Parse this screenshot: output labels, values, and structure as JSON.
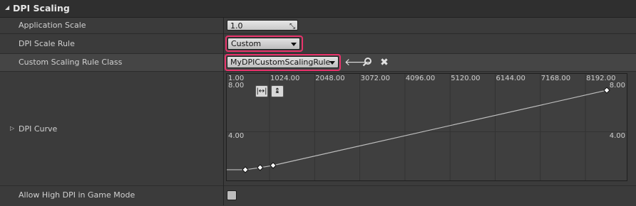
{
  "section": {
    "title": "DPI Scaling"
  },
  "rows": {
    "application_scale": {
      "label": "Application Scale",
      "value": "1.0"
    },
    "dpi_scale_rule": {
      "label": "DPI Scale Rule",
      "value": "Custom"
    },
    "custom_rule_class": {
      "label": "Custom Scaling Rule Class",
      "value": "MyDPICustomScalingRule"
    },
    "dpi_curve": {
      "label": "DPI Curve"
    },
    "allow_high_dpi": {
      "label": "Allow High DPI in Game Mode",
      "checked": false
    }
  },
  "icons": {
    "collapse": "triangle-down-icon",
    "expand": "triangle-right-icon",
    "resize": "resize-icon",
    "use_selected": "arrow-left-icon",
    "browse": "search-icon",
    "clear": "close-icon",
    "fit_horizontal": "fit-horizontal-icon",
    "fit_vertical": "fit-vertical-icon"
  },
  "chart_data": {
    "type": "line",
    "x_ticks": [
      "1.00",
      "1024.00",
      "2048.00",
      "3072.00",
      "4096.00",
      "5120.00",
      "6144.00",
      "7168.00",
      "8192.00"
    ],
    "y_ticks_left": [
      "8.00",
      "4.00"
    ],
    "y_ticks_right": [
      "8.00",
      "4.00"
    ],
    "xlim": [
      0,
      8192
    ],
    "ylim": [
      0,
      8.6
    ],
    "points": [
      {
        "x": 0,
        "y": 0.6
      },
      {
        "x": 400,
        "y": 0.6
      },
      {
        "x": 720,
        "y": 0.8
      },
      {
        "x": 1000,
        "y": 1.0
      },
      {
        "x": 8192,
        "y": 8.0
      }
    ],
    "keys": [
      {
        "x": 400,
        "y": 0.6
      },
      {
        "x": 720,
        "y": 0.8
      },
      {
        "x": 1000,
        "y": 1.0
      },
      {
        "x": 8192,
        "y": 8.0
      }
    ]
  }
}
